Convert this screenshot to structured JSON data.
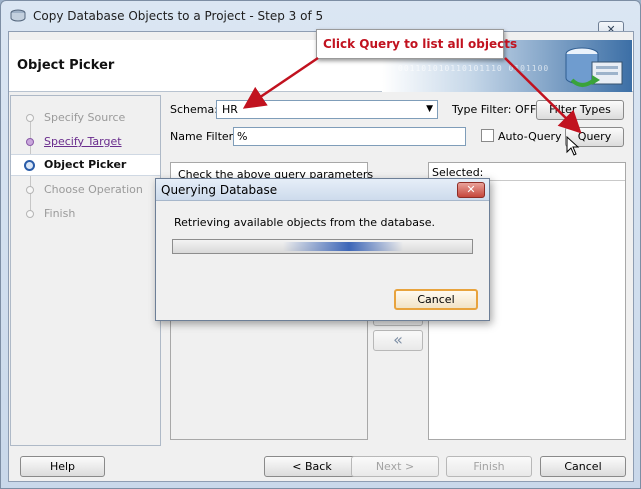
{
  "window": {
    "title": "Copy Database Objects to a Project - Step 3 of 5",
    "close_glyph": "✕"
  },
  "header": {
    "title": "Object Picker",
    "art_bits": "001101010110101110 0101100"
  },
  "callout": {
    "text": "Click Query to list all objects",
    "color": "#c1121f"
  },
  "steps": [
    {
      "label": "Specify Source",
      "state": "pending"
    },
    {
      "label": "Specify Target",
      "state": "visited"
    },
    {
      "label": "Object Picker",
      "state": "current"
    },
    {
      "label": "Choose Operation",
      "state": "pending"
    },
    {
      "label": "Finish",
      "state": "pending"
    }
  ],
  "form": {
    "schema_label": "Schema:",
    "schema_value": "HR",
    "type_filter": "Type Filter: OFF",
    "filter_types_button": "Filter Types",
    "name_filter_label": "Name Filter:",
    "name_filter_value": "%",
    "auto_query_label": "Auto-Query",
    "query_button": "Query",
    "available_hint": "Check the above query parameters",
    "selected_label": "Selected:",
    "move_all_left": "«"
  },
  "modal": {
    "title": "Querying Database",
    "message": "Retrieving available objects from the database.",
    "cancel_button": "Cancel",
    "close_glyph": "✕"
  },
  "footer": {
    "help": "Help",
    "back": "< Back",
    "next": "Next >",
    "finish": "Finish",
    "cancel": "Cancel"
  },
  "colors": {
    "accent_red": "#c1121f",
    "focus_orange": "#e8a33d",
    "current_step_blue": "#2a5ca8"
  }
}
